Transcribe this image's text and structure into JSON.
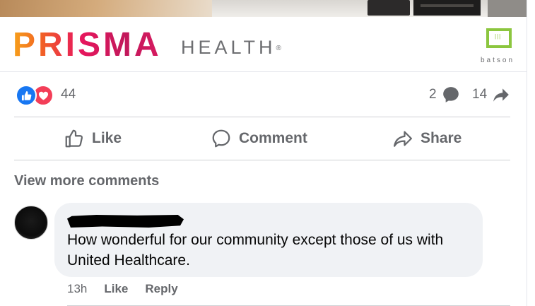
{
  "banner": {
    "brand_word": "PRISMA",
    "brand_sub": "HEALTH",
    "brand_reg": "®",
    "partner_name": "batson"
  },
  "reactions": {
    "count": "44",
    "types": [
      "like",
      "love"
    ],
    "colors": {
      "like": "#1877f2",
      "love": "#f33e58"
    }
  },
  "stats": {
    "comments": "2",
    "shares": "14"
  },
  "actions": {
    "like_label": "Like",
    "comment_label": "Comment",
    "share_label": "Share"
  },
  "comments_section": {
    "view_more_label": "View more comments",
    "items": [
      {
        "author": "",
        "author_redacted": true,
        "text": "How wonderful for our community except those of us with United Healthcare.",
        "time": "13h",
        "like_label": "Like",
        "reply_label": "Reply"
      }
    ]
  },
  "theme": {
    "muted_text": "#65676b",
    "bubble_bg": "#f0f2f5",
    "accent_green": "#8cc63f"
  }
}
